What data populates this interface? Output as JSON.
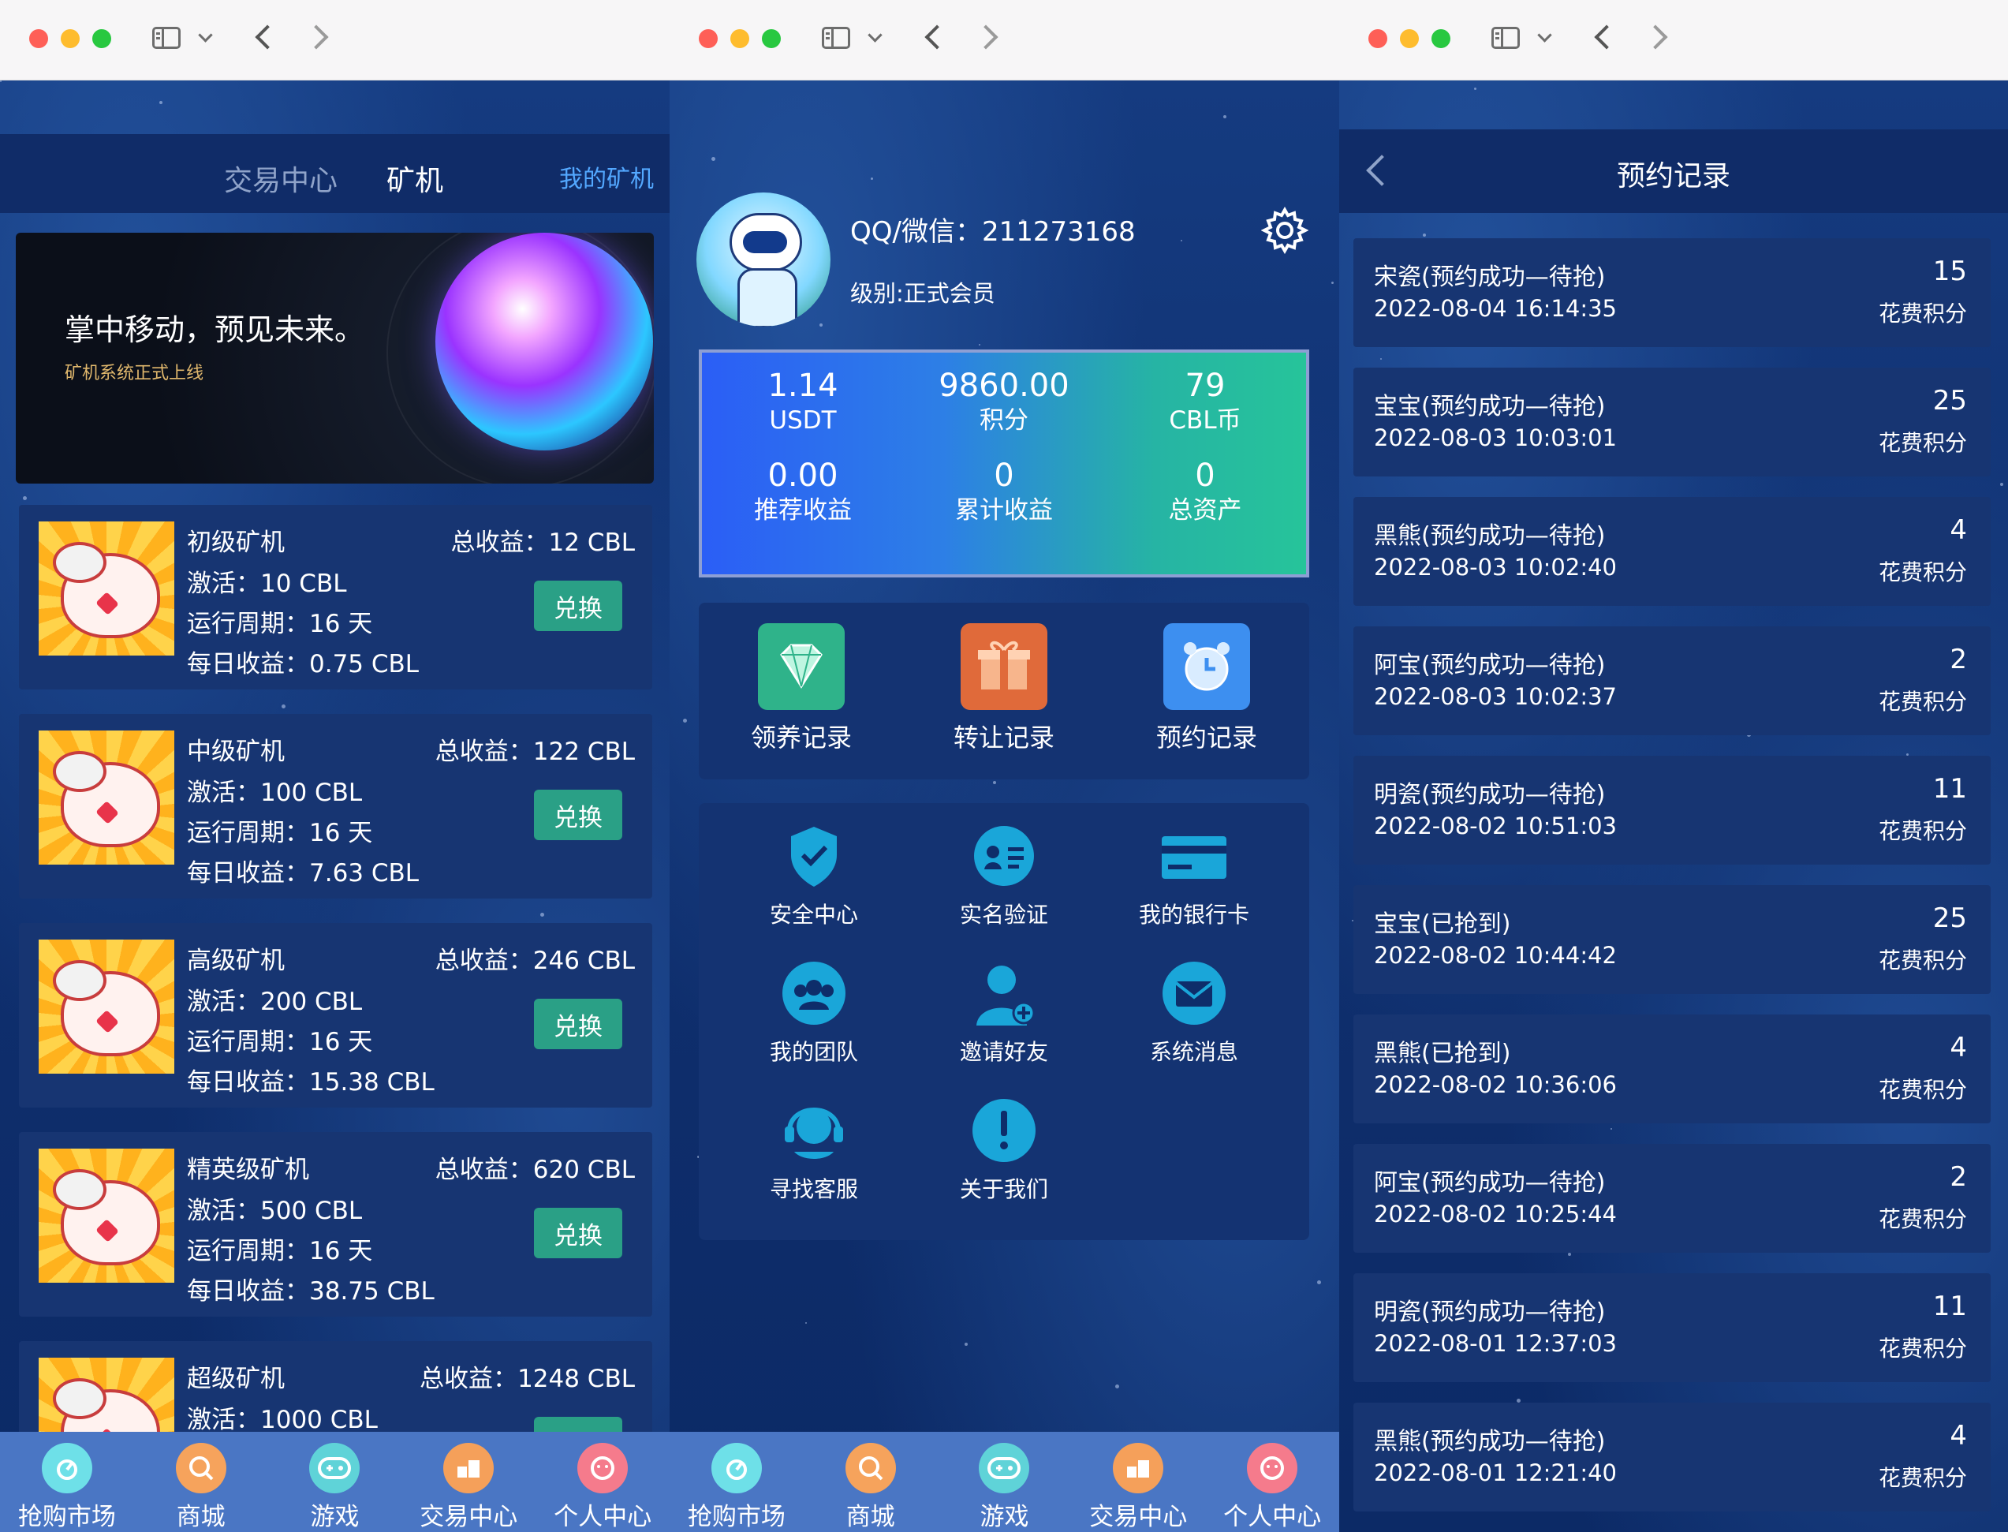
{
  "windows_chrome": {
    "traffic_lights": [
      "#fe5f57",
      "#febc2e",
      "#28c840"
    ]
  },
  "market": {
    "tabs": [
      "交易中心",
      "矿机"
    ],
    "my_miners": "我的矿机",
    "banner": {
      "title": "掌中移动，预见未来。",
      "subtitle": "矿机系统正式上线"
    },
    "total_prefix": "总收益：",
    "cards": [
      {
        "name": "初级矿机",
        "total": "12 CBL",
        "activate": "激活：10 CBL",
        "cycle": "运行周期：16 天",
        "daily": "每日收益：0.75 CBL",
        "button": "兑换"
      },
      {
        "name": "中级矿机",
        "total": "122 CBL",
        "activate": "激活：100 CBL",
        "cycle": "运行周期：16 天",
        "daily": "每日收益：7.63 CBL",
        "button": "兑换"
      },
      {
        "name": "高级矿机",
        "total": "246 CBL",
        "activate": "激活：200 CBL",
        "cycle": "运行周期：16 天",
        "daily": "每日收益：15.38 CBL",
        "button": "兑换"
      },
      {
        "name": "精英级矿机",
        "total": "620 CBL",
        "activate": "激活：500 CBL",
        "cycle": "运行周期：16 天",
        "daily": "每日收益：38.75 CBL",
        "button": "兑换"
      },
      {
        "name": "超级矿机",
        "total": "1248 CBL",
        "activate": "激活：1000 CBL",
        "cycle": "",
        "daily": "",
        "button": ""
      }
    ]
  },
  "tabbar": {
    "items": [
      {
        "label": "抢购市场",
        "icon": "snail-icon",
        "color": "#6ee0e8"
      },
      {
        "label": "商城",
        "icon": "lollipop-icon",
        "color": "#f6a35c"
      },
      {
        "label": "游戏",
        "icon": "gamepad-icon",
        "color": "#5fd3d8"
      },
      {
        "label": "交易中心",
        "icon": "blocks-icon",
        "color": "#f5a05a"
      },
      {
        "label": "个人中心",
        "icon": "face-icon",
        "color": "#f57b8c"
      }
    ]
  },
  "profile": {
    "contact": "QQ/微信：211273168",
    "level": "级别:正式会员",
    "stats": [
      {
        "value": "1.14",
        "label": "USDT"
      },
      {
        "value": "9860.00",
        "label": "积分"
      },
      {
        "value": "79",
        "label": "CBL币"
      },
      {
        "value": "0.00",
        "label": "推荐收益"
      },
      {
        "value": "0",
        "label": "累计收益"
      },
      {
        "value": "0",
        "label": "总资产"
      }
    ],
    "quick": [
      {
        "label": "领养记录",
        "icon": "diamond-icon",
        "color": "#2fb38a"
      },
      {
        "label": "转让记录",
        "icon": "gift-icon",
        "color": "#e06a3a"
      },
      {
        "label": "预约记录",
        "icon": "alarm-clock-icon",
        "color": "#3d8ff0"
      }
    ],
    "menu": [
      {
        "label": "安全中心",
        "icon": "shield-icon"
      },
      {
        "label": "实名验证",
        "icon": "id-card-icon"
      },
      {
        "label": "我的银行卡",
        "icon": "bank-card-icon"
      },
      {
        "label": "我的团队",
        "icon": "team-icon"
      },
      {
        "label": "邀请好友",
        "icon": "add-user-icon"
      },
      {
        "label": "系统消息",
        "icon": "mail-icon"
      },
      {
        "label": "寻找客服",
        "icon": "headset-icon"
      },
      {
        "label": "关于我们",
        "icon": "info-icon"
      }
    ],
    "menu_color": "#1aa6d9"
  },
  "records": {
    "title": "预约记录",
    "unit": "花费积分",
    "items": [
      {
        "name": "宋瓷(预约成功—待抢)",
        "time": "2022-08-04 16:14:35",
        "value": "15"
      },
      {
        "name": "宝宝(预约成功—待抢)",
        "time": "2022-08-03 10:03:01",
        "value": "25"
      },
      {
        "name": "黑熊(预约成功—待抢)",
        "time": "2022-08-03 10:02:40",
        "value": "4"
      },
      {
        "name": "阿宝(预约成功—待抢)",
        "time": "2022-08-03 10:02:37",
        "value": "2"
      },
      {
        "name": "明瓷(预约成功—待抢)",
        "time": "2022-08-02 10:51:03",
        "value": "11"
      },
      {
        "name": "宝宝(已抢到)",
        "time": "2022-08-02 10:44:42",
        "value": "25"
      },
      {
        "name": "黑熊(已抢到)",
        "time": "2022-08-02 10:36:06",
        "value": "4"
      },
      {
        "name": "阿宝(预约成功—待抢)",
        "time": "2022-08-02 10:25:44",
        "value": "2"
      },
      {
        "name": "明瓷(预约成功—待抢)",
        "time": "2022-08-01 12:37:03",
        "value": "11"
      },
      {
        "name": "黑熊(预约成功—待抢)",
        "time": "2022-08-01 12:21:40",
        "value": "4"
      }
    ]
  }
}
